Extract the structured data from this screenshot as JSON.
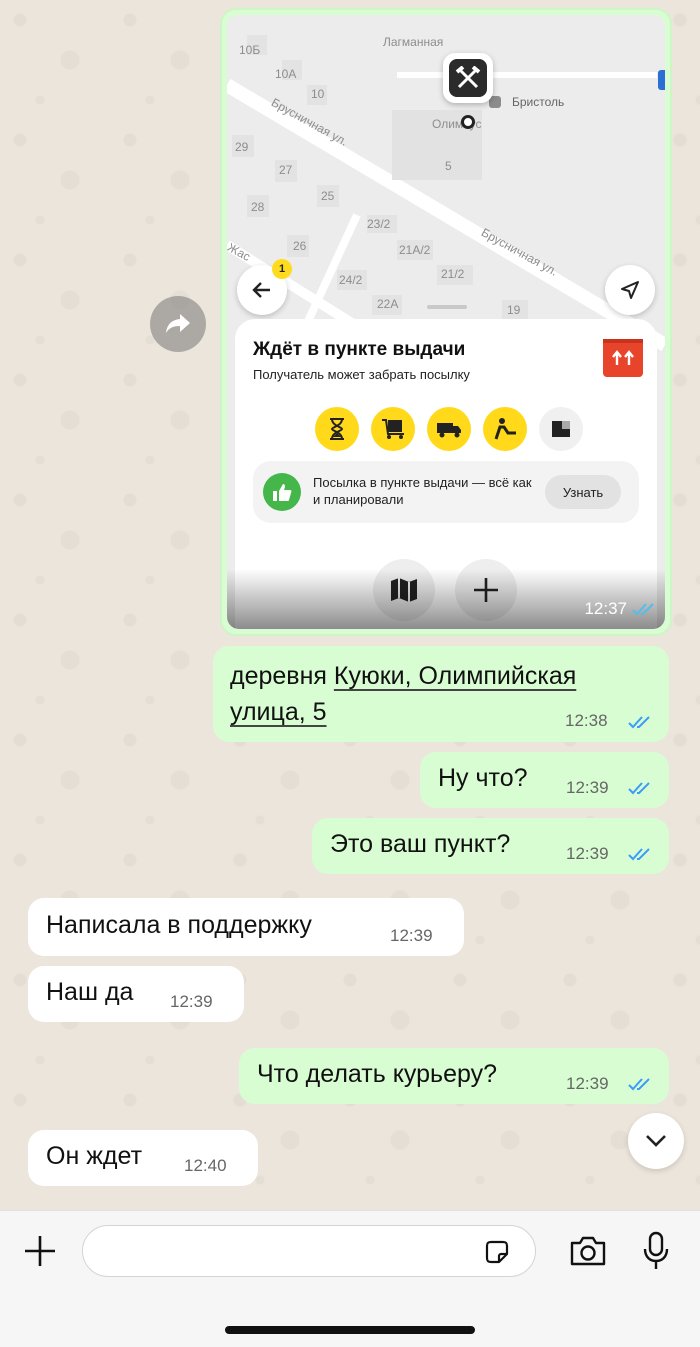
{
  "map": {
    "labels": [
      "Лагманная",
      "Бристоль",
      "Олимпус",
      "Брусничная ул.",
      "Брусничная ул.",
      "10Б",
      "10А",
      "10",
      "29",
      "27",
      "25",
      "28",
      "26",
      "5",
      "23/2",
      "21А/2",
      "21/2",
      "24/2",
      "22А",
      "19",
      "Жас"
    ],
    "badge": "1",
    "sheet": {
      "title": "Ждёт в пункте выдачи",
      "subtitle": "Получатель может забрать посылку",
      "info_text": "Посылка в пункте выдачи — всё как и планировали",
      "info_button": "Узнать"
    },
    "time": "12:37"
  },
  "messages": [
    {
      "dir": "out",
      "text_prefix": "деревня ",
      "text_link": "Куюки, Олимпийская улица, 5",
      "time": "12:38"
    },
    {
      "dir": "out",
      "text": "Ну что?",
      "time": "12:39"
    },
    {
      "dir": "out",
      "text": "Это ваш пункт?",
      "time": "12:39"
    },
    {
      "dir": "in",
      "text": "Написала в поддержку",
      "time": "12:39"
    },
    {
      "dir": "in",
      "text": "Наш да",
      "time": "12:39"
    },
    {
      "dir": "out",
      "text": "Что делать курьеру?",
      "time": "12:39"
    },
    {
      "dir": "in",
      "text": "Он ждет",
      "time": "12:40"
    }
  ],
  "input": {
    "placeholder": ""
  },
  "colors": {
    "outgoing": "#d9fdd3",
    "incoming": "#ffffff",
    "read_ticks": "#3b9df5",
    "accent_yellow": "#ffd91a"
  }
}
